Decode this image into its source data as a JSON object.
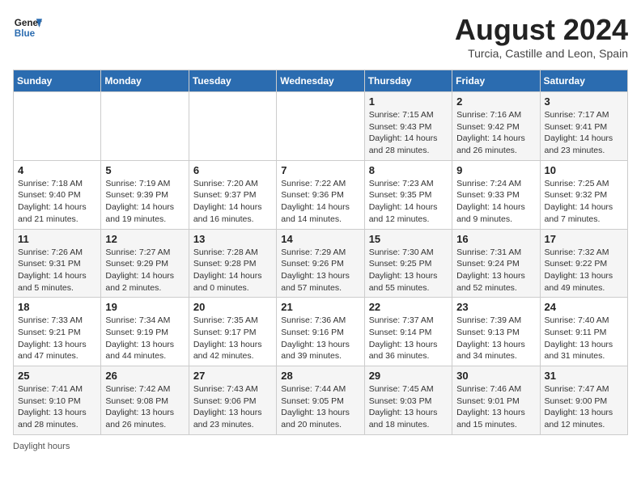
{
  "header": {
    "logo_line1": "General",
    "logo_line2": "Blue",
    "month_title": "August 2024",
    "subtitle": "Turcia, Castille and Leon, Spain"
  },
  "days_of_week": [
    "Sunday",
    "Monday",
    "Tuesday",
    "Wednesday",
    "Thursday",
    "Friday",
    "Saturday"
  ],
  "weeks": [
    [
      {
        "day": "",
        "info": ""
      },
      {
        "day": "",
        "info": ""
      },
      {
        "day": "",
        "info": ""
      },
      {
        "day": "",
        "info": ""
      },
      {
        "day": "1",
        "info": "Sunrise: 7:15 AM\nSunset: 9:43 PM\nDaylight: 14 hours\nand 28 minutes."
      },
      {
        "day": "2",
        "info": "Sunrise: 7:16 AM\nSunset: 9:42 PM\nDaylight: 14 hours\nand 26 minutes."
      },
      {
        "day": "3",
        "info": "Sunrise: 7:17 AM\nSunset: 9:41 PM\nDaylight: 14 hours\nand 23 minutes."
      }
    ],
    [
      {
        "day": "4",
        "info": "Sunrise: 7:18 AM\nSunset: 9:40 PM\nDaylight: 14 hours\nand 21 minutes."
      },
      {
        "day": "5",
        "info": "Sunrise: 7:19 AM\nSunset: 9:39 PM\nDaylight: 14 hours\nand 19 minutes."
      },
      {
        "day": "6",
        "info": "Sunrise: 7:20 AM\nSunset: 9:37 PM\nDaylight: 14 hours\nand 16 minutes."
      },
      {
        "day": "7",
        "info": "Sunrise: 7:22 AM\nSunset: 9:36 PM\nDaylight: 14 hours\nand 14 minutes."
      },
      {
        "day": "8",
        "info": "Sunrise: 7:23 AM\nSunset: 9:35 PM\nDaylight: 14 hours\nand 12 minutes."
      },
      {
        "day": "9",
        "info": "Sunrise: 7:24 AM\nSunset: 9:33 PM\nDaylight: 14 hours\nand 9 minutes."
      },
      {
        "day": "10",
        "info": "Sunrise: 7:25 AM\nSunset: 9:32 PM\nDaylight: 14 hours\nand 7 minutes."
      }
    ],
    [
      {
        "day": "11",
        "info": "Sunrise: 7:26 AM\nSunset: 9:31 PM\nDaylight: 14 hours\nand 5 minutes."
      },
      {
        "day": "12",
        "info": "Sunrise: 7:27 AM\nSunset: 9:29 PM\nDaylight: 14 hours\nand 2 minutes."
      },
      {
        "day": "13",
        "info": "Sunrise: 7:28 AM\nSunset: 9:28 PM\nDaylight: 14 hours\nand 0 minutes."
      },
      {
        "day": "14",
        "info": "Sunrise: 7:29 AM\nSunset: 9:26 PM\nDaylight: 13 hours\nand 57 minutes."
      },
      {
        "day": "15",
        "info": "Sunrise: 7:30 AM\nSunset: 9:25 PM\nDaylight: 13 hours\nand 55 minutes."
      },
      {
        "day": "16",
        "info": "Sunrise: 7:31 AM\nSunset: 9:24 PM\nDaylight: 13 hours\nand 52 minutes."
      },
      {
        "day": "17",
        "info": "Sunrise: 7:32 AM\nSunset: 9:22 PM\nDaylight: 13 hours\nand 49 minutes."
      }
    ],
    [
      {
        "day": "18",
        "info": "Sunrise: 7:33 AM\nSunset: 9:21 PM\nDaylight: 13 hours\nand 47 minutes."
      },
      {
        "day": "19",
        "info": "Sunrise: 7:34 AM\nSunset: 9:19 PM\nDaylight: 13 hours\nand 44 minutes."
      },
      {
        "day": "20",
        "info": "Sunrise: 7:35 AM\nSunset: 9:17 PM\nDaylight: 13 hours\nand 42 minutes."
      },
      {
        "day": "21",
        "info": "Sunrise: 7:36 AM\nSunset: 9:16 PM\nDaylight: 13 hours\nand 39 minutes."
      },
      {
        "day": "22",
        "info": "Sunrise: 7:37 AM\nSunset: 9:14 PM\nDaylight: 13 hours\nand 36 minutes."
      },
      {
        "day": "23",
        "info": "Sunrise: 7:39 AM\nSunset: 9:13 PM\nDaylight: 13 hours\nand 34 minutes."
      },
      {
        "day": "24",
        "info": "Sunrise: 7:40 AM\nSunset: 9:11 PM\nDaylight: 13 hours\nand 31 minutes."
      }
    ],
    [
      {
        "day": "25",
        "info": "Sunrise: 7:41 AM\nSunset: 9:10 PM\nDaylight: 13 hours\nand 28 minutes."
      },
      {
        "day": "26",
        "info": "Sunrise: 7:42 AM\nSunset: 9:08 PM\nDaylight: 13 hours\nand 26 minutes."
      },
      {
        "day": "27",
        "info": "Sunrise: 7:43 AM\nSunset: 9:06 PM\nDaylight: 13 hours\nand 23 minutes."
      },
      {
        "day": "28",
        "info": "Sunrise: 7:44 AM\nSunset: 9:05 PM\nDaylight: 13 hours\nand 20 minutes."
      },
      {
        "day": "29",
        "info": "Sunrise: 7:45 AM\nSunset: 9:03 PM\nDaylight: 13 hours\nand 18 minutes."
      },
      {
        "day": "30",
        "info": "Sunrise: 7:46 AM\nSunset: 9:01 PM\nDaylight: 13 hours\nand 15 minutes."
      },
      {
        "day": "31",
        "info": "Sunrise: 7:47 AM\nSunset: 9:00 PM\nDaylight: 13 hours\nand 12 minutes."
      }
    ]
  ],
  "footer": {
    "daylight_label": "Daylight hours"
  }
}
